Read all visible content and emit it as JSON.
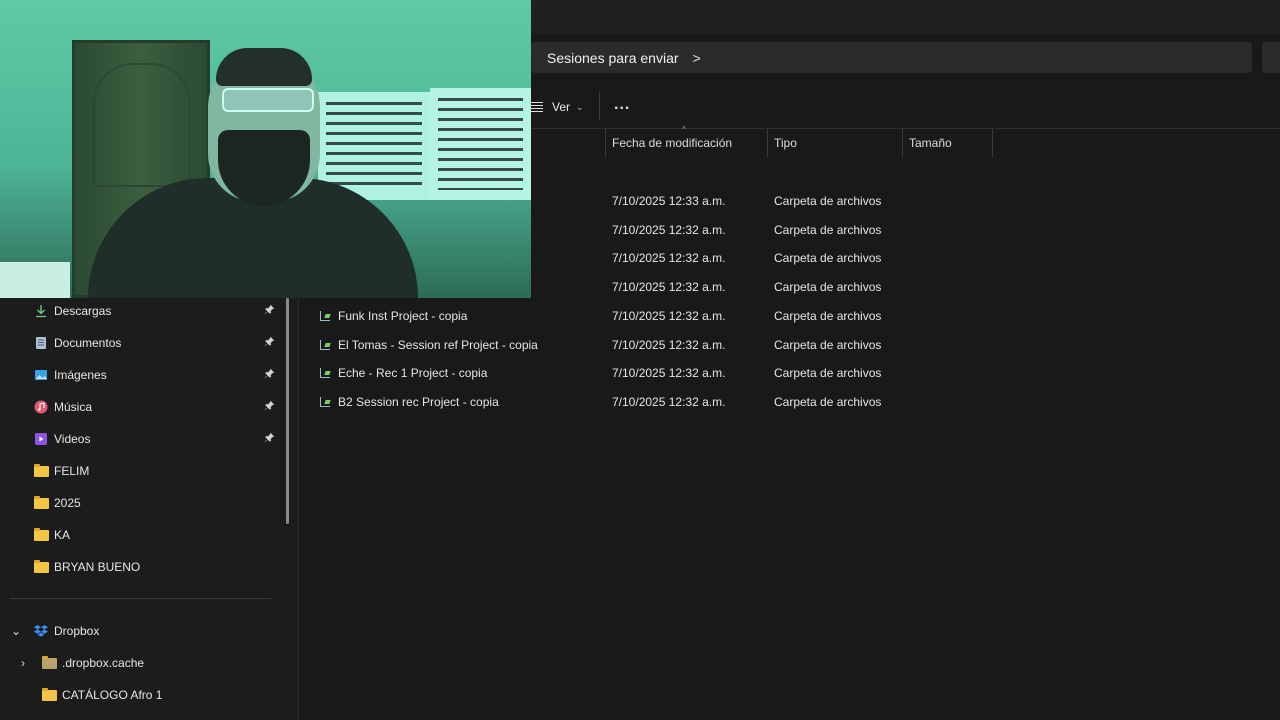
{
  "window": {
    "breadcrumb": "Sesiones para enviar",
    "breadcrumb_chevron": ">"
  },
  "commandbar": {
    "view_label": "Ver",
    "more_label": "..."
  },
  "columns": {
    "date": "Fecha de modificación",
    "type": "Tipo",
    "size": "Tamaño"
  },
  "files": [
    {
      "name": "",
      "date": "7/10/2025 12:33 a.m.",
      "type": "Carpeta de archivos"
    },
    {
      "name": "",
      "date": "7/10/2025 12:32 a.m.",
      "type": "Carpeta de archivos"
    },
    {
      "name": "",
      "date": "7/10/2025 12:32 a.m.",
      "type": "Carpeta de archivos"
    },
    {
      "name": "",
      "date": "7/10/2025 12:32 a.m.",
      "type": "Carpeta de archivos"
    },
    {
      "name": "Funk Inst Project - copia",
      "date": "7/10/2025 12:32 a.m.",
      "type": "Carpeta de archivos"
    },
    {
      "name": "El Tomas - Session ref Project - copia",
      "date": "7/10/2025 12:32 a.m.",
      "type": "Carpeta de archivos"
    },
    {
      "name": "Eche - Rec 1 Project - copia",
      "date": "7/10/2025 12:32 a.m.",
      "type": "Carpeta de archivos"
    },
    {
      "name": "B2 Session rec Project - copia",
      "date": "7/10/2025 12:32 a.m.",
      "type": "Carpeta de archivos"
    }
  ],
  "sidebar": {
    "quick_access": [
      {
        "label": "Descargas",
        "icon": "download-icon",
        "pinned": true
      },
      {
        "label": "Documentos",
        "icon": "document-icon",
        "pinned": true
      },
      {
        "label": "Imágenes",
        "icon": "image-icon",
        "pinned": true
      },
      {
        "label": "Música",
        "icon": "music-icon",
        "pinned": true
      },
      {
        "label": "Videos",
        "icon": "video-icon",
        "pinned": true
      },
      {
        "label": "FELIM",
        "icon": "folder-icon",
        "pinned": false
      },
      {
        "label": "2025",
        "icon": "folder-icon",
        "pinned": false
      },
      {
        "label": "KA",
        "icon": "folder-icon",
        "pinned": false
      },
      {
        "label": "BRYAN BUENO",
        "icon": "folder-icon",
        "pinned": false
      }
    ],
    "dropbox": {
      "label": "Dropbox",
      "children": [
        {
          "label": ".dropbox.cache"
        },
        {
          "label": "CATÁLOGO Afro 1"
        }
      ]
    }
  },
  "colors": {
    "background": "#191919",
    "folder": "#f3c646",
    "dropbox": "#3d8cf0",
    "webcam_tint": "#5fcaa7"
  }
}
